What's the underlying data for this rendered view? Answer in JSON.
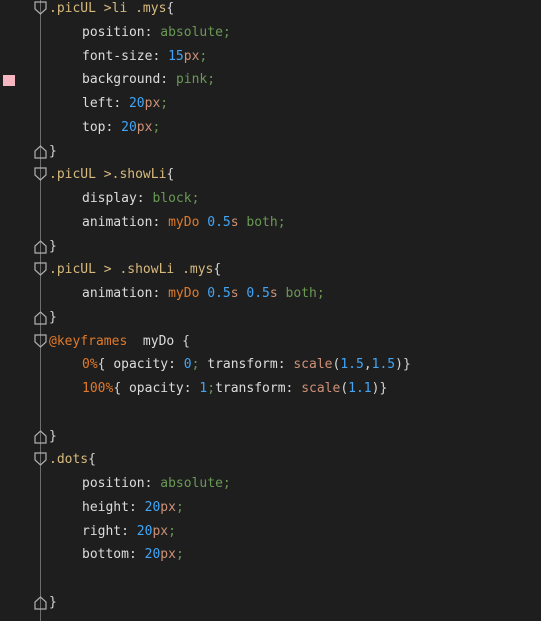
{
  "editor": {
    "swatch_color": "#f5b5c1",
    "lines": [
      {
        "parts": [
          {
            "t": ".picUL ",
            "c": "t-sel"
          },
          {
            "t": ">li ",
            "c": "t-sel"
          },
          {
            "t": ".mys",
            "c": "t-sel"
          },
          {
            "t": "{",
            "c": "t-brace"
          }
        ],
        "indent": 0,
        "fold": "open"
      },
      {
        "parts": [
          {
            "t": "position",
            "c": "t-prop"
          },
          {
            "t": ": ",
            "c": "t-punct"
          },
          {
            "t": "absolute",
            "c": "t-val"
          },
          {
            "t": ";",
            "c": "t-val"
          }
        ],
        "indent": 1
      },
      {
        "parts": [
          {
            "t": "font-size",
            "c": "t-prop"
          },
          {
            "t": ": ",
            "c": "t-punct"
          },
          {
            "t": "15",
            "c": "t-num"
          },
          {
            "t": "px",
            "c": "t-unit"
          },
          {
            "t": ";",
            "c": "t-val"
          }
        ],
        "indent": 1
      },
      {
        "parts": [
          {
            "t": "background",
            "c": "t-prop"
          },
          {
            "t": ": ",
            "c": "t-punct"
          },
          {
            "t": "pink",
            "c": "t-val"
          },
          {
            "t": ";",
            "c": "t-val"
          }
        ],
        "indent": 1,
        "swatch": true
      },
      {
        "parts": [
          {
            "t": "left",
            "c": "t-prop"
          },
          {
            "t": ": ",
            "c": "t-punct"
          },
          {
            "t": "20",
            "c": "t-num"
          },
          {
            "t": "px",
            "c": "t-unit"
          },
          {
            "t": ";",
            "c": "t-val"
          }
        ],
        "indent": 1
      },
      {
        "parts": [
          {
            "t": "top",
            "c": "t-prop"
          },
          {
            "t": ": ",
            "c": "t-punct"
          },
          {
            "t": "20",
            "c": "t-num"
          },
          {
            "t": "px",
            "c": "t-unit"
          },
          {
            "t": ";",
            "c": "t-val"
          }
        ],
        "indent": 1
      },
      {
        "parts": [
          {
            "t": "}",
            "c": "t-brace"
          }
        ],
        "indent": 0,
        "fold": "close"
      },
      {
        "parts": [
          {
            "t": ".picUL ",
            "c": "t-sel"
          },
          {
            "t": ">",
            "c": "t-sel"
          },
          {
            "t": ".showLi",
            "c": "t-sel"
          },
          {
            "t": "{",
            "c": "t-brace"
          }
        ],
        "indent": 0,
        "fold": "open"
      },
      {
        "parts": [
          {
            "t": "display",
            "c": "t-prop"
          },
          {
            "t": ": ",
            "c": "t-punct"
          },
          {
            "t": "block",
            "c": "t-val"
          },
          {
            "t": ";",
            "c": "t-val"
          }
        ],
        "indent": 1
      },
      {
        "parts": [
          {
            "t": "animation",
            "c": "t-prop"
          },
          {
            "t": ": ",
            "c": "t-punct"
          },
          {
            "t": "myDo ",
            "c": "t-key"
          },
          {
            "t": "0.5",
            "c": "t-num"
          },
          {
            "t": "s ",
            "c": "t-unit"
          },
          {
            "t": "both",
            "c": "t-val"
          },
          {
            "t": ";",
            "c": "t-val"
          }
        ],
        "indent": 1
      },
      {
        "parts": [
          {
            "t": "}",
            "c": "t-brace"
          }
        ],
        "indent": 0,
        "fold": "close"
      },
      {
        "parts": [
          {
            "t": ".picUL ",
            "c": "t-sel"
          },
          {
            "t": "> ",
            "c": "t-sel"
          },
          {
            "t": ".showLi ",
            "c": "t-sel"
          },
          {
            "t": ".mys",
            "c": "t-sel"
          },
          {
            "t": "{",
            "c": "t-brace"
          }
        ],
        "indent": 0,
        "fold": "open"
      },
      {
        "parts": [
          {
            "t": "animation",
            "c": "t-prop"
          },
          {
            "t": ": ",
            "c": "t-punct"
          },
          {
            "t": "myDo ",
            "c": "t-key"
          },
          {
            "t": "0.5",
            "c": "t-num"
          },
          {
            "t": "s ",
            "c": "t-unit"
          },
          {
            "t": "0.5",
            "c": "t-num"
          },
          {
            "t": "s ",
            "c": "t-unit"
          },
          {
            "t": "both",
            "c": "t-val"
          },
          {
            "t": ";",
            "c": "t-val"
          }
        ],
        "indent": 1
      },
      {
        "parts": [
          {
            "t": "}",
            "c": "t-brace"
          }
        ],
        "indent": 0,
        "fold": "close"
      },
      {
        "parts": [
          {
            "t": "@keyframes ",
            "c": "t-key"
          },
          {
            "t": " myDo ",
            "c": "t-prop"
          },
          {
            "t": "{",
            "c": "t-brace"
          }
        ],
        "indent": 0,
        "fold": "open"
      },
      {
        "parts": [
          {
            "t": "0%",
            "c": "t-key"
          },
          {
            "t": "{ ",
            "c": "t-brace"
          },
          {
            "t": "opacity",
            "c": "t-prop"
          },
          {
            "t": ": ",
            "c": "t-punct"
          },
          {
            "t": "0",
            "c": "t-num"
          },
          {
            "t": "; ",
            "c": "t-val"
          },
          {
            "t": "transform",
            "c": "t-prop"
          },
          {
            "t": ": ",
            "c": "t-punct"
          },
          {
            "t": "scale",
            "c": "t-fn"
          },
          {
            "t": "(",
            "c": "t-punct"
          },
          {
            "t": "1.5",
            "c": "t-num"
          },
          {
            "t": ",",
            "c": "t-punct"
          },
          {
            "t": "1.5",
            "c": "t-num"
          },
          {
            "t": ")}",
            "c": "t-punct"
          }
        ],
        "indent": 1
      },
      {
        "parts": [
          {
            "t": "100%",
            "c": "t-key"
          },
          {
            "t": "{ ",
            "c": "t-brace"
          },
          {
            "t": "opacity",
            "c": "t-prop"
          },
          {
            "t": ": ",
            "c": "t-punct"
          },
          {
            "t": "1",
            "c": "t-num"
          },
          {
            "t": ";",
            "c": "t-val"
          },
          {
            "t": "transform",
            "c": "t-prop"
          },
          {
            "t": ": ",
            "c": "t-punct"
          },
          {
            "t": "scale",
            "c": "t-fn"
          },
          {
            "t": "(",
            "c": "t-punct"
          },
          {
            "t": "1.1",
            "c": "t-num"
          },
          {
            "t": ")}",
            "c": "t-punct"
          }
        ],
        "indent": 1
      },
      {
        "parts": [],
        "indent": 0
      },
      {
        "parts": [
          {
            "t": "}",
            "c": "t-brace"
          }
        ],
        "indent": 0,
        "fold": "close"
      },
      {
        "parts": [
          {
            "t": ".dots",
            "c": "t-sel"
          },
          {
            "t": "{",
            "c": "t-brace"
          }
        ],
        "indent": 0,
        "fold": "open"
      },
      {
        "parts": [
          {
            "t": "position",
            "c": "t-prop"
          },
          {
            "t": ": ",
            "c": "t-punct"
          },
          {
            "t": "absolute",
            "c": "t-val"
          },
          {
            "t": ";",
            "c": "t-val"
          }
        ],
        "indent": 1
      },
      {
        "parts": [
          {
            "t": "height",
            "c": "t-prop"
          },
          {
            "t": ": ",
            "c": "t-punct"
          },
          {
            "t": "20",
            "c": "t-num"
          },
          {
            "t": "px",
            "c": "t-unit"
          },
          {
            "t": ";",
            "c": "t-val"
          }
        ],
        "indent": 1
      },
      {
        "parts": [
          {
            "t": "right",
            "c": "t-prop"
          },
          {
            "t": ": ",
            "c": "t-punct"
          },
          {
            "t": "20",
            "c": "t-num"
          },
          {
            "t": "px",
            "c": "t-unit"
          },
          {
            "t": ";",
            "c": "t-val"
          }
        ],
        "indent": 1
      },
      {
        "parts": [
          {
            "t": "bottom",
            "c": "t-prop"
          },
          {
            "t": ": ",
            "c": "t-punct"
          },
          {
            "t": "20",
            "c": "t-num"
          },
          {
            "t": "px",
            "c": "t-unit"
          },
          {
            "t": ";",
            "c": "t-val"
          }
        ],
        "indent": 1
      },
      {
        "parts": [],
        "indent": 0
      },
      {
        "parts": [
          {
            "t": "}",
            "c": "t-brace"
          }
        ],
        "indent": 0,
        "fold": "close"
      }
    ]
  }
}
